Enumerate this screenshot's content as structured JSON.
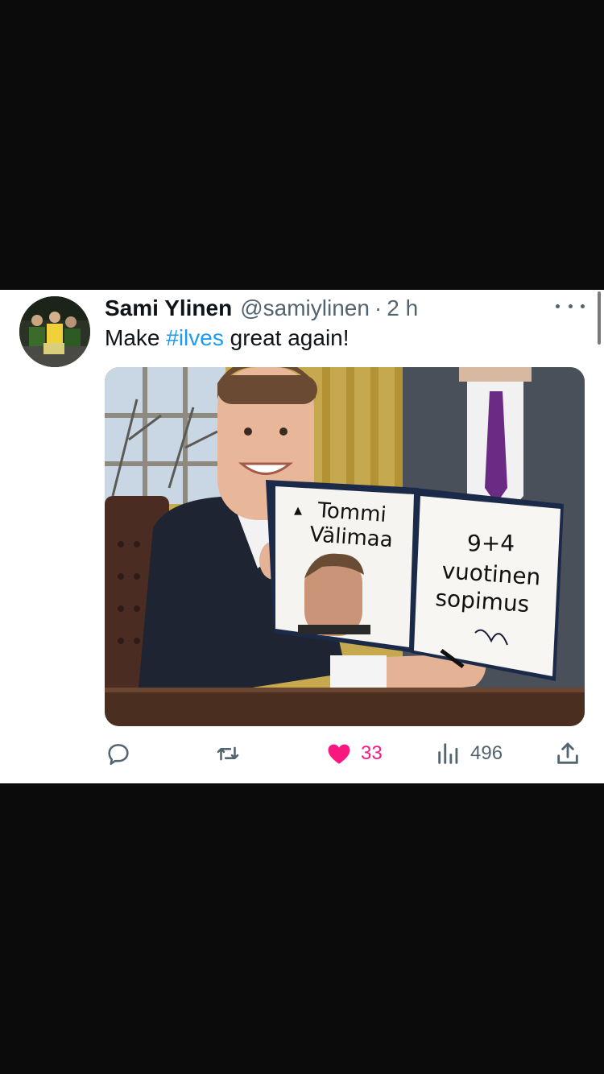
{
  "tweet": {
    "author_name": "Sami Ylinen",
    "author_handle": "@samiylinen",
    "separator": "·",
    "time": "2 h",
    "text_before": "Make ",
    "hashtag": "#ilves",
    "text_after": " great again!"
  },
  "media": {
    "left_page_name_line1": "Tommi",
    "left_page_name_line2": "Välimaa",
    "right_page_line1": "9+4",
    "right_page_line2": "vuotinen",
    "right_page_line3": "sopimus"
  },
  "actions": {
    "reply_count": "",
    "retweet_count": "",
    "like_count": "33",
    "views_count": "496",
    "like_active": true,
    "like_color": "#f91880",
    "icon_color": "#536471"
  },
  "icons": {
    "reply": "reply-icon",
    "retweet": "retweet-icon",
    "like": "heart-icon",
    "views": "views-icon",
    "share": "share-icon",
    "more": "more-icon"
  },
  "colors": {
    "hashtag": "#1d9bf0",
    "text": "#0f1419",
    "secondary": "#536471"
  }
}
